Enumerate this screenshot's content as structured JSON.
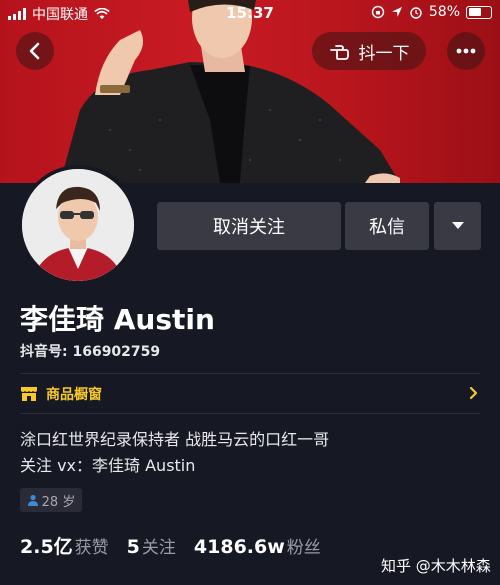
{
  "status_bar": {
    "carrier": "中国联通",
    "time": "15:37",
    "battery": "58%"
  },
  "header": {
    "shake_label": "抖一下"
  },
  "actions": {
    "unfollow_label": "取消关注",
    "message_label": "私信"
  },
  "profile": {
    "name": "李佳琦 Austin",
    "douyin_id": "抖音号: 166902759",
    "shop_label": "商品橱窗",
    "bio_line1": "涂口红世界纪录保持者 战胜马云的口红一哥",
    "bio_line2": "关注 vx：李佳琦 Austin",
    "age_tag": "28 岁"
  },
  "stats": [
    {
      "value": "2.5亿",
      "label": "获赞"
    },
    {
      "value": "5",
      "label": "关注"
    },
    {
      "value": "4186.6w",
      "label": "粉丝"
    }
  ],
  "watermark": "知乎 @木木林森",
  "colors": {
    "background": "#161823",
    "banner_red": "#c91b24",
    "button_gray": "#3a3a45",
    "shop_yellow": "#f8c82a"
  }
}
